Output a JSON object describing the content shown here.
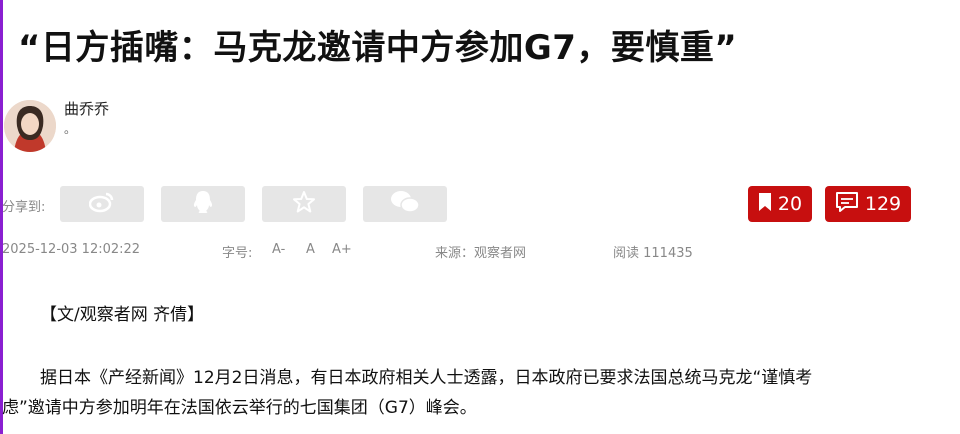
{
  "article": {
    "title": "“日方插嘴：马克龙邀请中方参加G7，要慎重”",
    "author": {
      "name": "曲乔乔",
      "desc": "。"
    },
    "share": {
      "label": "分享到:",
      "icons": [
        "weibo-icon",
        "qq-icon",
        "star-icon",
        "wechat-icon"
      ]
    },
    "stats": {
      "bookmarks": "20",
      "comments": "129"
    },
    "meta": {
      "date": "2025-12-03 12:02:22",
      "font_size_label": "字号:",
      "font_minus": "A-",
      "font_normal": "A",
      "font_plus": "A+",
      "source": "来源：观察者网",
      "reads": "阅读 111435"
    },
    "body": {
      "byline": "【文/观察者网 齐倩】",
      "para1_line1": "据日本《产经新闻》12月2日消息，有日本政府相关人士透露，日本政府已要求法国总统马克龙“谨慎考",
      "para1_line2": "虑”邀请中方参加明年在法国依云举行的七国集团（G7）峰会。"
    }
  },
  "colors": {
    "accent": "#c70f0f",
    "share_bg": "#e6e6e6",
    "muted": "#888888"
  }
}
